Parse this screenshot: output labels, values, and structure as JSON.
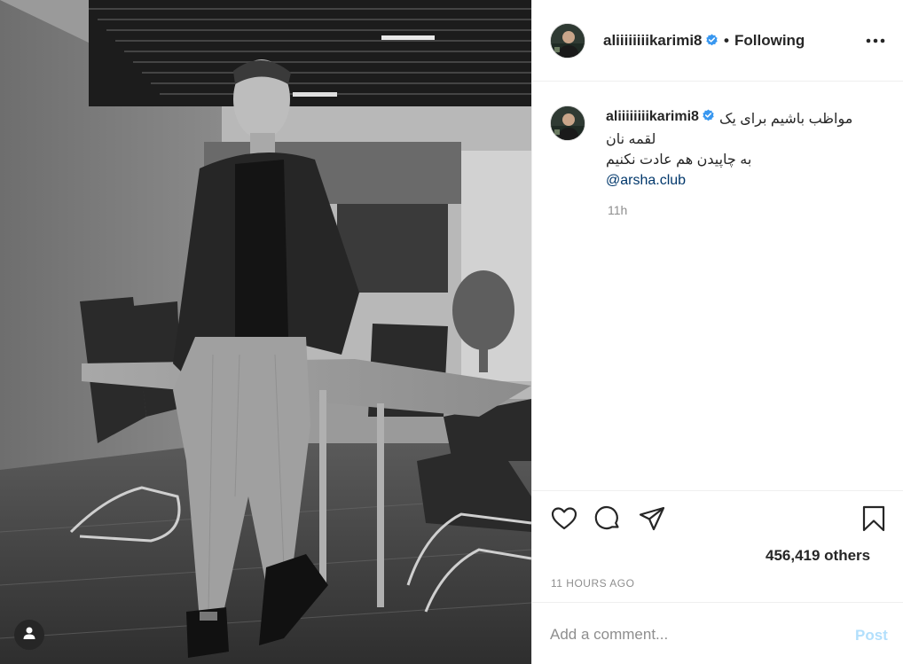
{
  "post": {
    "username": "aliiiiiiiikarimi8",
    "follow_status": "Following",
    "separator": "•",
    "caption_lines": [
      "مواظب باشیم برای یک",
      "لقمه نان",
      "به چاپیدن هم عادت نکنیم"
    ],
    "caption_mention": "@arsha.club",
    "caption_time": "11h",
    "likes_text": "456,419 others",
    "time_ago": "11 HOURS AGO"
  },
  "comment_box": {
    "placeholder": "Add a comment...",
    "post_label": "Post"
  },
  "icons": {
    "verified": "verified-badge-icon",
    "more": "more-options-icon",
    "like": "heart-icon",
    "comment": "comment-bubble-icon",
    "share": "paper-plane-icon",
    "save": "bookmark-icon",
    "tagged_users": "user-tag-icon"
  },
  "colors": {
    "verified_blue": "#3897f0",
    "link_blue": "#00376b",
    "post_button_disabled": "#b2dffc",
    "muted_text": "#8e8e8e"
  }
}
